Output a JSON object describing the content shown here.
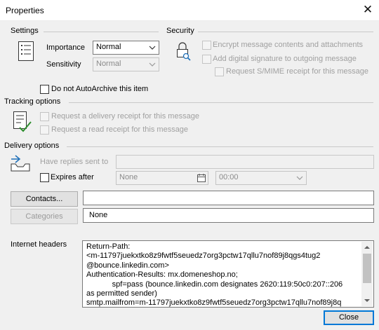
{
  "window": {
    "title": "Properties",
    "close_glyph": "✕"
  },
  "settings": {
    "group_label": "Settings",
    "importance_label": "Importance",
    "importance_value": "Normal",
    "sensitivity_label": "Sensitivity",
    "sensitivity_value": "Normal",
    "autoarchive_label": "Do not AutoArchive this item"
  },
  "security": {
    "group_label": "Security",
    "encrypt_label": "Encrypt message contents and attachments",
    "signature_label": "Add digital signature to outgoing message",
    "smime_label": "Request S/MIME receipt for this message"
  },
  "tracking": {
    "group_label": "Tracking options",
    "delivery_receipt_label": "Request a delivery receipt for this message",
    "read_receipt_label": "Request a read receipt for this message"
  },
  "delivery": {
    "group_label": "Delivery options",
    "replies_label": "Have replies sent to",
    "replies_value": "",
    "expires_label": "Expires after",
    "expires_date": "None",
    "expires_time": "00:00",
    "contacts_button": "Contacts...",
    "contacts_value": "",
    "categories_button": "Categories",
    "categories_value": "None"
  },
  "headers": {
    "label": "Internet headers",
    "text": "Return-Path:\n<m-11797juekxtko8z9fwtf5seuedz7org3pctw17qllu7nof89j8qgs4tug2\n@bounce.linkedin.com>\nAuthentication-Results: mx.domeneshop.no;\n            spf=pass (bounce.linkedin.com designates 2620:119:50c0:207::206\nas permitted sender)\nsmtp.mailfrom=m-11797juekxtko8z9fwtf5seuedz7org3pctw17qllu7nof89j8q"
  },
  "footer": {
    "close_button": "Close"
  },
  "icons": [
    "settings-list-icon",
    "lock-magnifier-icon",
    "tracking-check-icon",
    "delivery-tray-icon",
    "calendar-icon",
    "dropdown-arrow-icon",
    "scroll-up-icon",
    "scroll-down-icon"
  ],
  "colors": {
    "dialog_bg": "#f0f0f0",
    "accent": "#0078d7",
    "disabled_text": "#a0a0a0"
  }
}
